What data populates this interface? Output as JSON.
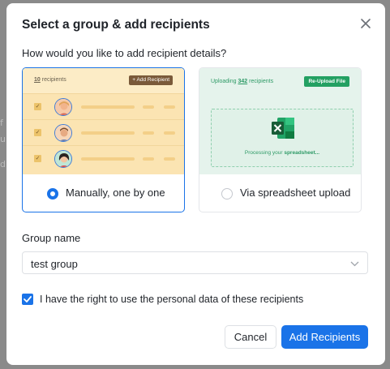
{
  "dialog": {
    "title": "Select a group & add recipients",
    "question": "How would you like to add recipient details?",
    "close_icon": "close-icon"
  },
  "options": {
    "manual": {
      "label": "Manually, one by one",
      "selected": true,
      "preview": {
        "count": "10",
        "count_suffix": "recipients",
        "add_button": "+ Add Recipient",
        "rows": [
          {
            "checked": true,
            "avatar": "woman-avatar"
          },
          {
            "checked": true,
            "avatar": "man-avatar"
          },
          {
            "checked": true,
            "avatar": "woman-avatar"
          }
        ]
      }
    },
    "spreadsheet": {
      "label": "Via spreadsheet upload",
      "selected": false,
      "preview": {
        "uploading_prefix": "Uploading",
        "uploading_count": "342",
        "uploading_suffix": "recipients",
        "reupload_button": "Re-Upload File",
        "processing_prefix": "Processing your",
        "processing_bold": "spreadsheet...",
        "file_icon": "excel-icon"
      }
    }
  },
  "group": {
    "label": "Group name",
    "value": "test group"
  },
  "consent": {
    "checked": true,
    "label": "I have the right to use the personal data of these recipients"
  },
  "buttons": {
    "cancel": "Cancel",
    "add": "Add Recipients"
  },
  "colors": {
    "accent": "#1a73e8",
    "manual_preview_bg": "#fbe4b2",
    "upload_preview_bg": "#e5f3ec",
    "upload_accent": "#23a062"
  }
}
